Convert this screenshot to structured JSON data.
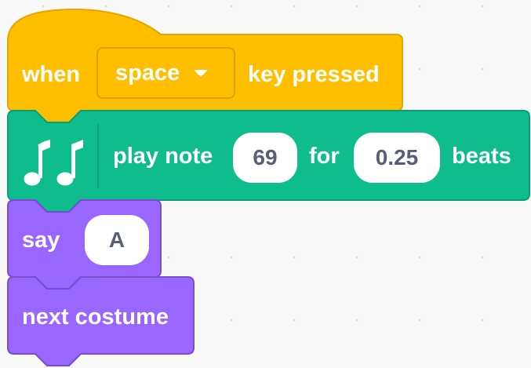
{
  "blocks": {
    "event": {
      "when_label": "when",
      "key_value": "space",
      "key_pressed_label": "key pressed"
    },
    "play_note": {
      "icon": "music-notes-icon",
      "play_note_label": "play note",
      "note_value": "69",
      "for_label": "for",
      "beats_value": "0.25",
      "beats_label": "beats"
    },
    "say": {
      "say_label": "say",
      "message_value": "A"
    },
    "next_costume": {
      "label": "next costume"
    }
  },
  "colors": {
    "event_fill": "#ffbf00",
    "event_border": "#e6a400",
    "music_fill": "#0fbd8c",
    "music_border": "#0b9e74",
    "looks_fill": "#9966ff",
    "looks_border": "#774dcb",
    "canvas_background": "#f9f9f9"
  }
}
